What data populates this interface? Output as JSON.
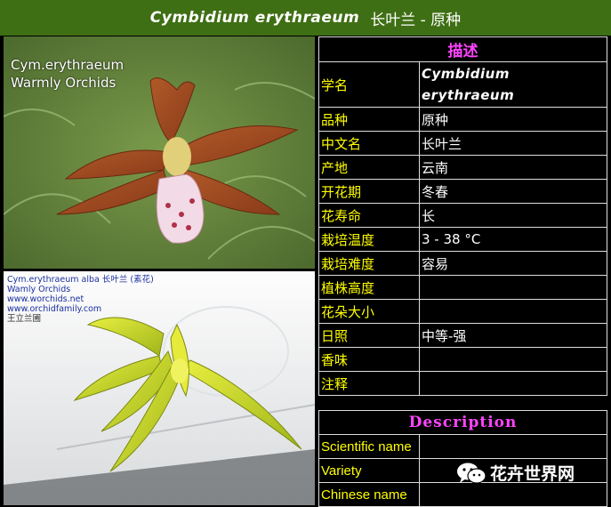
{
  "title": {
    "latin": "Cymbidium erythraeum",
    "chinese": "长叶兰 - 原种"
  },
  "photo1": {
    "caption_line1": "Cym.erythraeum",
    "caption_line2": "Warmly Orchids"
  },
  "photo2": {
    "caption_line1": "Cym.erythraeum alba 长叶兰 (素花)",
    "caption_line2": "Wamly Orchids",
    "caption_line3": "www.worchids.net",
    "caption_line4": "www.orchidfamily.com",
    "caption_line5": "王立兰圃"
  },
  "table_cn": {
    "header": "描述",
    "rows": [
      {
        "k": "学名",
        "v": "Cymbidium erythraeum"
      },
      {
        "k": "品种",
        "v": "原种"
      },
      {
        "k": "中文名",
        "v": "长叶兰"
      },
      {
        "k": "产地",
        "v": "云南"
      },
      {
        "k": "开花期",
        "v": "冬春"
      },
      {
        "k": "花寿命",
        "v": "长"
      },
      {
        "k": "栽培温度",
        "v": "3 - 38 °C"
      },
      {
        "k": "栽培难度",
        "v": "容易"
      },
      {
        "k": "植株高度",
        "v": ""
      },
      {
        "k": "花朵大小",
        "v": ""
      },
      {
        "k": "日照",
        "v": "中等-强"
      },
      {
        "k": "香味",
        "v": ""
      },
      {
        "k": "注释",
        "v": ""
      }
    ]
  },
  "table_en": {
    "header": "Description",
    "rows": [
      {
        "k": "Scientific name",
        "v": ""
      },
      {
        "k": "Variety",
        "v": ""
      },
      {
        "k": "Chinese name",
        "v": ""
      }
    ]
  },
  "watermark": {
    "text": "花卉世界网"
  },
  "colors": {
    "title_bg": "#3f6f14",
    "label": "#ffff00",
    "header": "#ff44ff"
  }
}
